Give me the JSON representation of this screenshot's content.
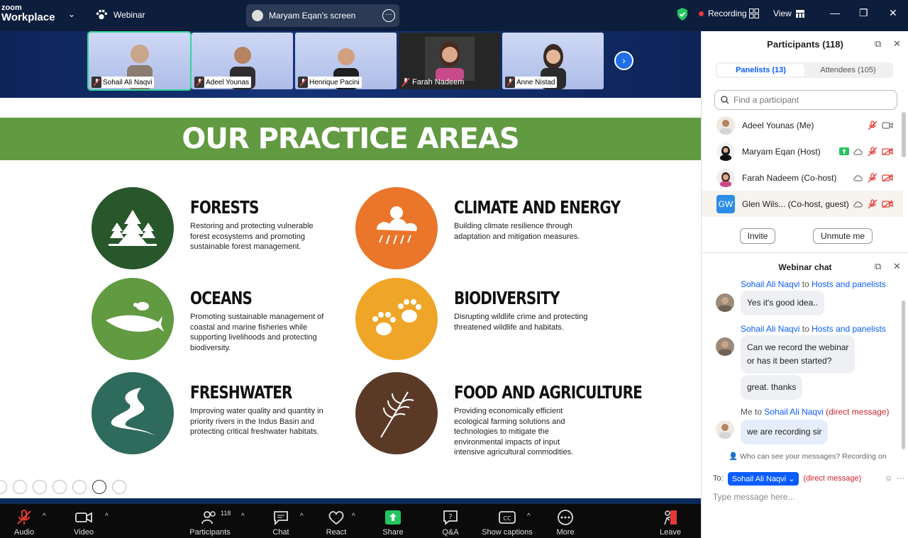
{
  "app": {
    "logo_small": "zoom",
    "logo_big": "Workplace",
    "mode": "Webinar",
    "screen_share_label": "Maryam Eqan's screen",
    "recording": "Recording",
    "view": "View"
  },
  "thumbnails": [
    {
      "name": "Sohail Ali Naqvi"
    },
    {
      "name": "Adeel Younas"
    },
    {
      "name": "Henrique Pacini"
    },
    {
      "name": "Farah Nadeem"
    },
    {
      "name": "Anne Nistad"
    }
  ],
  "slide": {
    "banner": "OUR PRACTICE AREAS",
    "areas": [
      {
        "title": "FORESTS",
        "desc": "Restoring and protecting vulnerable forest ecosystems and promoting sustainable forest management.",
        "color": "#28572c"
      },
      {
        "title": "CLIMATE AND ENERGY",
        "desc": "Building climate resilience through adaptation and mitigation measures.",
        "color": "#ea762b"
      },
      {
        "title": "OCEANS",
        "desc": "Promoting sustainable management of coastal and marine fisheries while supporting livelihoods and protecting biodiversity.",
        "color": "#619a41"
      },
      {
        "title": "BIODIVERSITY",
        "desc": "Disrupting wildlife crime and protecting threatened wildlife and habitats.",
        "color": "#efa527"
      },
      {
        "title": "FRESHWATER",
        "desc": "Improving water quality and quantity in priority rivers in the Indus Basin and protecting critical freshwater habitats.",
        "color": "#2f6b5c"
      },
      {
        "title": "FOOD AND AGRICULTURE",
        "desc": "Providing economically efficient ecological farming solutions and technologies to mitigate the environmental impacts of input intensive agricultural commodities.",
        "color": "#5a3a27"
      }
    ]
  },
  "toolbar": {
    "audio": "Audio",
    "video": "Video",
    "participants": "Participants",
    "participants_count": "118",
    "chat": "Chat",
    "react": "React",
    "share": "Share",
    "qa": "Q&A",
    "captions": "Show captions",
    "more": "More",
    "leave": "Leave"
  },
  "participants_panel": {
    "title": "Participants (118)",
    "tab_panelists": "Panelists (13)",
    "tab_attendees": "Attendees (105)",
    "search_placeholder": "Find a participant",
    "rows": [
      {
        "name": "Adeel Younas  (Me)"
      },
      {
        "name": "Maryam Eqan (Host)"
      },
      {
        "name": "Farah Nadeem (Co-host)"
      },
      {
        "name": "Glen Wils...  (Co-host, guest)",
        "initials": "GW"
      }
    ],
    "invite": "Invite",
    "unmute_me": "Unmute me"
  },
  "chat_panel": {
    "title": "Webinar chat",
    "messages": [
      {
        "from": "Sohail Ali Naqvi",
        "to_word": "to",
        "to": "Hosts and panelists",
        "text": "Yes it's good idea.."
      },
      {
        "from": "Sohail Ali Naqvi",
        "to_word": "to",
        "to": "Hosts and panelists",
        "text": "Can we record the webinar",
        "text2": "or has it been started?",
        "followup": "great. thanks"
      },
      {
        "from": "Me",
        "to_word": "to",
        "to": "Sohail Ali Naqvi",
        "dm": "(direct message)",
        "text": "we are recording sir"
      }
    ],
    "visibility_note": "Who can see your messages? Recording on",
    "to_label": "To:",
    "to_recipient": "Sohail Ali Naqvi",
    "to_dm": "(direct message)",
    "input_placeholder": "Type message here..."
  }
}
